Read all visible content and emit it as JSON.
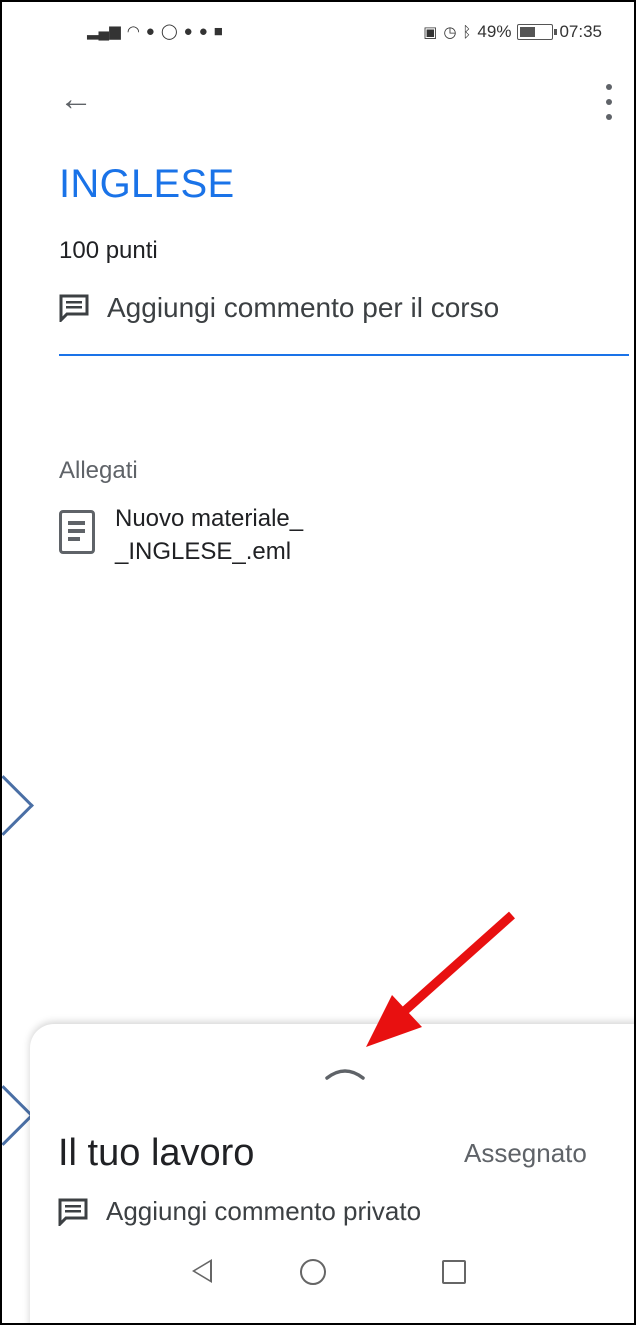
{
  "status_bar": {
    "battery_percent": "49%",
    "time": "07:35"
  },
  "assignment": {
    "title": "INGLESE",
    "points": "100 punti",
    "class_comment_label": "Aggiungi commento per il corso"
  },
  "attachments": {
    "heading": "Allegati",
    "items": [
      {
        "line1": "Nuovo materiale_",
        "line2": "_INGLESE_.eml"
      }
    ]
  },
  "your_work": {
    "title": "Il tuo lavoro",
    "status": "Assegnato",
    "private_comment_label": "Aggiungi commento privato"
  },
  "colors": {
    "accent": "#1a73e8",
    "annotation_arrow": "#e81010",
    "chevron": "#4a6fa5"
  },
  "icons": {
    "back": "arrow-left-icon",
    "more": "more-vert-icon",
    "comment": "comment-icon",
    "document": "document-icon",
    "expand": "expand-less-icon"
  }
}
